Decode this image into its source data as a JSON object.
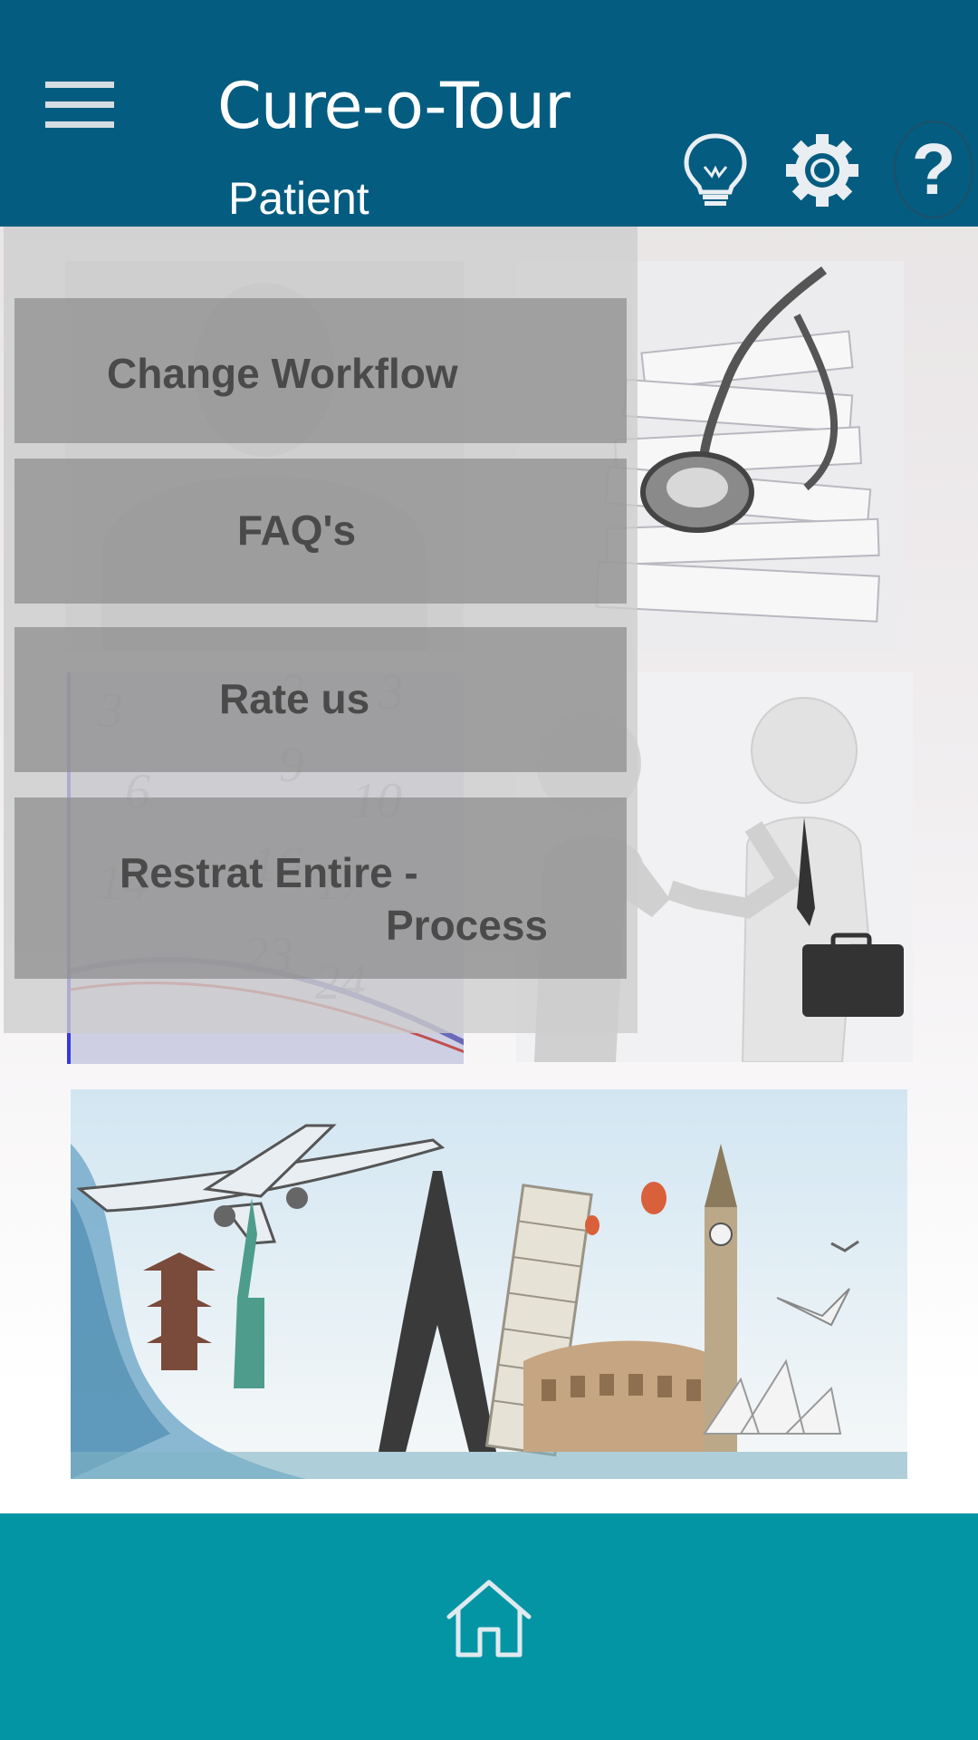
{
  "app": {
    "title": "Cure-o-Tour",
    "subtitle": "Patient"
  },
  "header": {
    "icons": [
      "menu-icon",
      "lightbulb-icon",
      "gear-icon",
      "help-icon"
    ],
    "help_glyph": "?"
  },
  "menu": {
    "items": [
      {
        "label": "Change Workflow"
      },
      {
        "label": "FAQ's"
      },
      {
        "label": "Rate us"
      },
      {
        "label_line1": "Restrat Entire -",
        "label_line2": "Process"
      }
    ]
  },
  "tiles": [
    "patient-profile-image",
    "medical-records-image",
    "calendar-image",
    "partner-handshake-image",
    "travel-landmarks-image"
  ],
  "footer": {
    "icon": "home-icon"
  },
  "colors": {
    "header_bg": "#045c80",
    "footer_bg": "#0495a5",
    "menu_item_bg": "#8c8c8c",
    "menu_text": "#4a4a4a"
  }
}
